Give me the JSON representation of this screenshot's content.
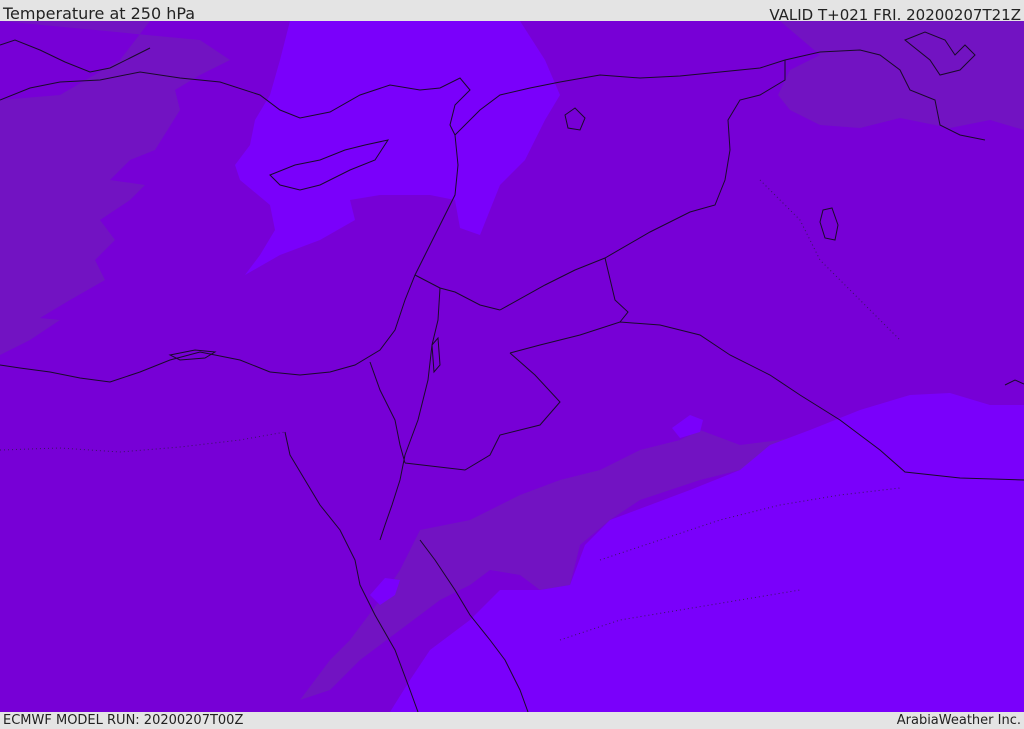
{
  "header": {
    "title": "Temperature at 250 hPa",
    "valid": "VALID T+021 FRI. 20200207T21Z"
  },
  "footer": {
    "model_run": "ECMWF MODEL RUN: 20200207T00Z",
    "credit": "ArabiaWeather Inc."
  },
  "map": {
    "fill_colors": {
      "base": "#7700d6",
      "warmer_band": "#7213c2",
      "colder_band": "#7a00fb",
      "coastline": "#1a0a2a",
      "border_dotted": "#3a1460"
    }
  }
}
